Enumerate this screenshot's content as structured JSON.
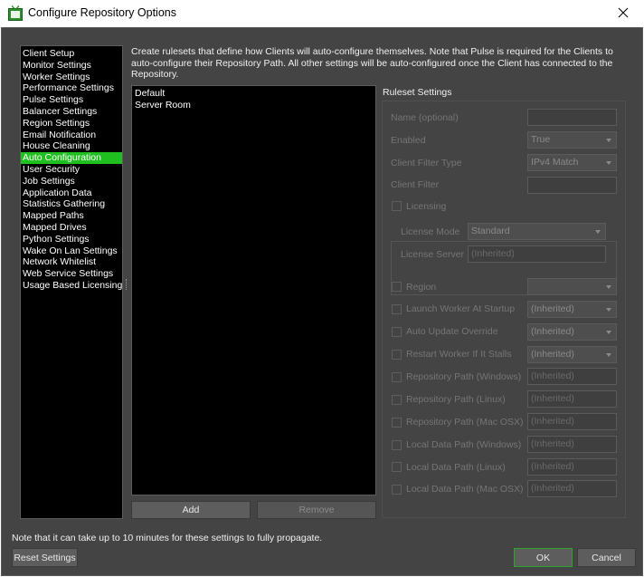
{
  "window": {
    "title": "Configure Repository Options",
    "close_icon": "close-icon",
    "app_icon": "deadline-monitor-icon"
  },
  "sidebar": {
    "items": [
      {
        "label": "Client Setup"
      },
      {
        "label": "Monitor Settings"
      },
      {
        "label": "Worker Settings"
      },
      {
        "label": "Performance Settings"
      },
      {
        "label": "Pulse Settings"
      },
      {
        "label": "Balancer Settings"
      },
      {
        "label": "Region Settings"
      },
      {
        "label": "Email Notification"
      },
      {
        "label": "House Cleaning"
      },
      {
        "label": "Auto Configuration",
        "active": true
      },
      {
        "label": "User Security"
      },
      {
        "label": "Job Settings"
      },
      {
        "label": "Application Data"
      },
      {
        "label": "Statistics Gathering"
      },
      {
        "label": "Mapped Paths"
      },
      {
        "label": "Mapped Drives"
      },
      {
        "label": "Python Settings"
      },
      {
        "label": "Wake On Lan Settings"
      },
      {
        "label": "Network Whitelist"
      },
      {
        "label": "Web Service Settings"
      },
      {
        "label": "Usage Based Licensing"
      }
    ],
    "active_color": "#1fbf1f"
  },
  "main": {
    "description": "Create rulesets that define how Clients will auto-configure themselves. Note that Pulse is required for the Clients to auto-configure their Repository Path. All other settings will be auto-configured once the Client has connected to the Repository.",
    "rulesets": [
      "Default",
      "Server Room"
    ],
    "add_label": "Add",
    "remove_label": "Remove"
  },
  "ruleset_settings": {
    "title": "Ruleset Settings",
    "name_label": "Name (optional)",
    "name_value": "",
    "enabled_label": "Enabled",
    "enabled_value": "True",
    "client_filter_type_label": "Client Filter Type",
    "client_filter_type_value": "IPv4 Match",
    "client_filter_label": "Client Filter",
    "client_filter_value": "",
    "licensing_label": "Licensing",
    "license_mode_label": "License Mode",
    "license_mode_value": "Standard",
    "license_server_label": "License Server",
    "license_server_placeholder": "(Inherited)",
    "region_label": "Region",
    "region_value": "",
    "launch_worker_label": "Launch Worker At Startup",
    "launch_worker_value": "(Inherited)",
    "auto_update_label": "Auto Update Override",
    "auto_update_value": "(Inherited)",
    "restart_worker_label": "Restart Worker If It Stalls",
    "restart_worker_value": "(Inherited)",
    "repo_path_windows_label": "Repository Path (Windows)",
    "repo_path_linux_label": "Repository Path (Linux)",
    "repo_path_mac_label": "Repository Path (Mac OSX)",
    "local_data_windows_label": "Local Data Path (Windows)",
    "local_data_linux_label": "Local Data Path (Linux)",
    "local_data_mac_label": "Local Data Path (Mac OSX)",
    "inherited_placeholder": "(Inherited)"
  },
  "footer": {
    "note": "Note that it can take up to 10 minutes for these settings to fully propagate.",
    "reset_label": "Reset Settings",
    "ok_label": "OK",
    "cancel_label": "Cancel",
    "ok_border_color": "#2aa52a"
  }
}
